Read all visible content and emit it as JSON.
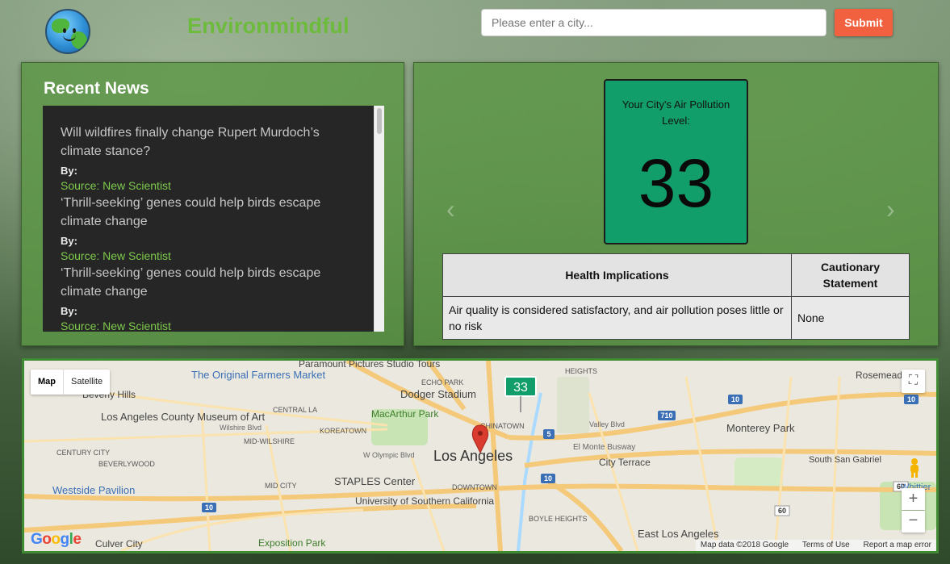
{
  "header": {
    "logo_icon": "earth-smiley-icon",
    "brand": "Environmindful",
    "city_placeholder": "Please enter a city...",
    "submit_label": "Submit"
  },
  "news": {
    "title": "Recent News",
    "items": [
      {
        "headline": "Will wildfires finally change Rupert Murdoch’s climate stance?",
        "by": "By:",
        "source": "Source: New Scientist"
      },
      {
        "headline": "‘Thrill-seeking’ genes could help birds escape climate change",
        "by": "By:",
        "source": "Source: New Scientist"
      },
      {
        "headline": "‘Thrill-seeking’ genes could help birds escape climate change",
        "by": "By:",
        "source": "Source: New Scientist"
      }
    ]
  },
  "aqi": {
    "label": "Your City's Air Pollution Level:",
    "value": "33",
    "box_color": "#129e6a",
    "prev_arrow": "‹",
    "next_arrow": "›",
    "table": {
      "header_health": "Health Implications",
      "header_caution": "Cautionary Statement",
      "health": "Air quality is considered satisfactory, and air pollution poses little or no risk",
      "caution": "None"
    }
  },
  "map": {
    "type_map": "Map",
    "type_satellite": "Satellite",
    "marker_label": "33",
    "logo": "Google",
    "footer_data": "Map data ©2018 Google",
    "footer_terms": "Terms of Use",
    "footer_report": "Report a map error",
    "zoom_in": "+",
    "zoom_out": "−",
    "labels": {
      "los_angeles": "Los Angeles",
      "original_farmers": "The Original Farmers Market",
      "beverly_hills": "Beverly Hills",
      "la_county_museum": "Los Angeles County Museum of Art",
      "dodger_stadium": "Dodger Stadium",
      "macarthur_park": "MacArthur Park",
      "paramount": "Paramount Pictures Studio Tours",
      "echo_park": "ECHO PARK",
      "monterey_park": "Monterey Park",
      "city_terrace": "City Terrace",
      "south_san_gabriel": "South San Gabriel",
      "rosemead": "Rosemead",
      "staples": "STAPLES Center",
      "usc": "University of Southern California",
      "exposition": "Exposition Park",
      "westside": "Westside Pavilion",
      "culver_city": "Culver City",
      "east_los_angeles": "East Los Angeles",
      "downtown": "DOWNTOWN",
      "koreatown": "KOREATOWN",
      "mid_wilshire": "MID-WILSHIRE",
      "mid_city": "MID CITY",
      "century_city": "CENTURY CITY",
      "beverlywood": "BEVERLYWOOD",
      "central_la": "CENTRAL LA",
      "boyle_heights": "BOYLE HEIGHTS",
      "chinatown": "CHINATOWN",
      "wilshire_blvd": "Wilshire Blvd",
      "olympic_blvd": "W Olympic Blvd",
      "el_monte_busway": "El Monte Busway",
      "valley_blvd": "Valley Blvd",
      "whittier": "Whittier",
      "heights": "HEIGHTS"
    }
  }
}
